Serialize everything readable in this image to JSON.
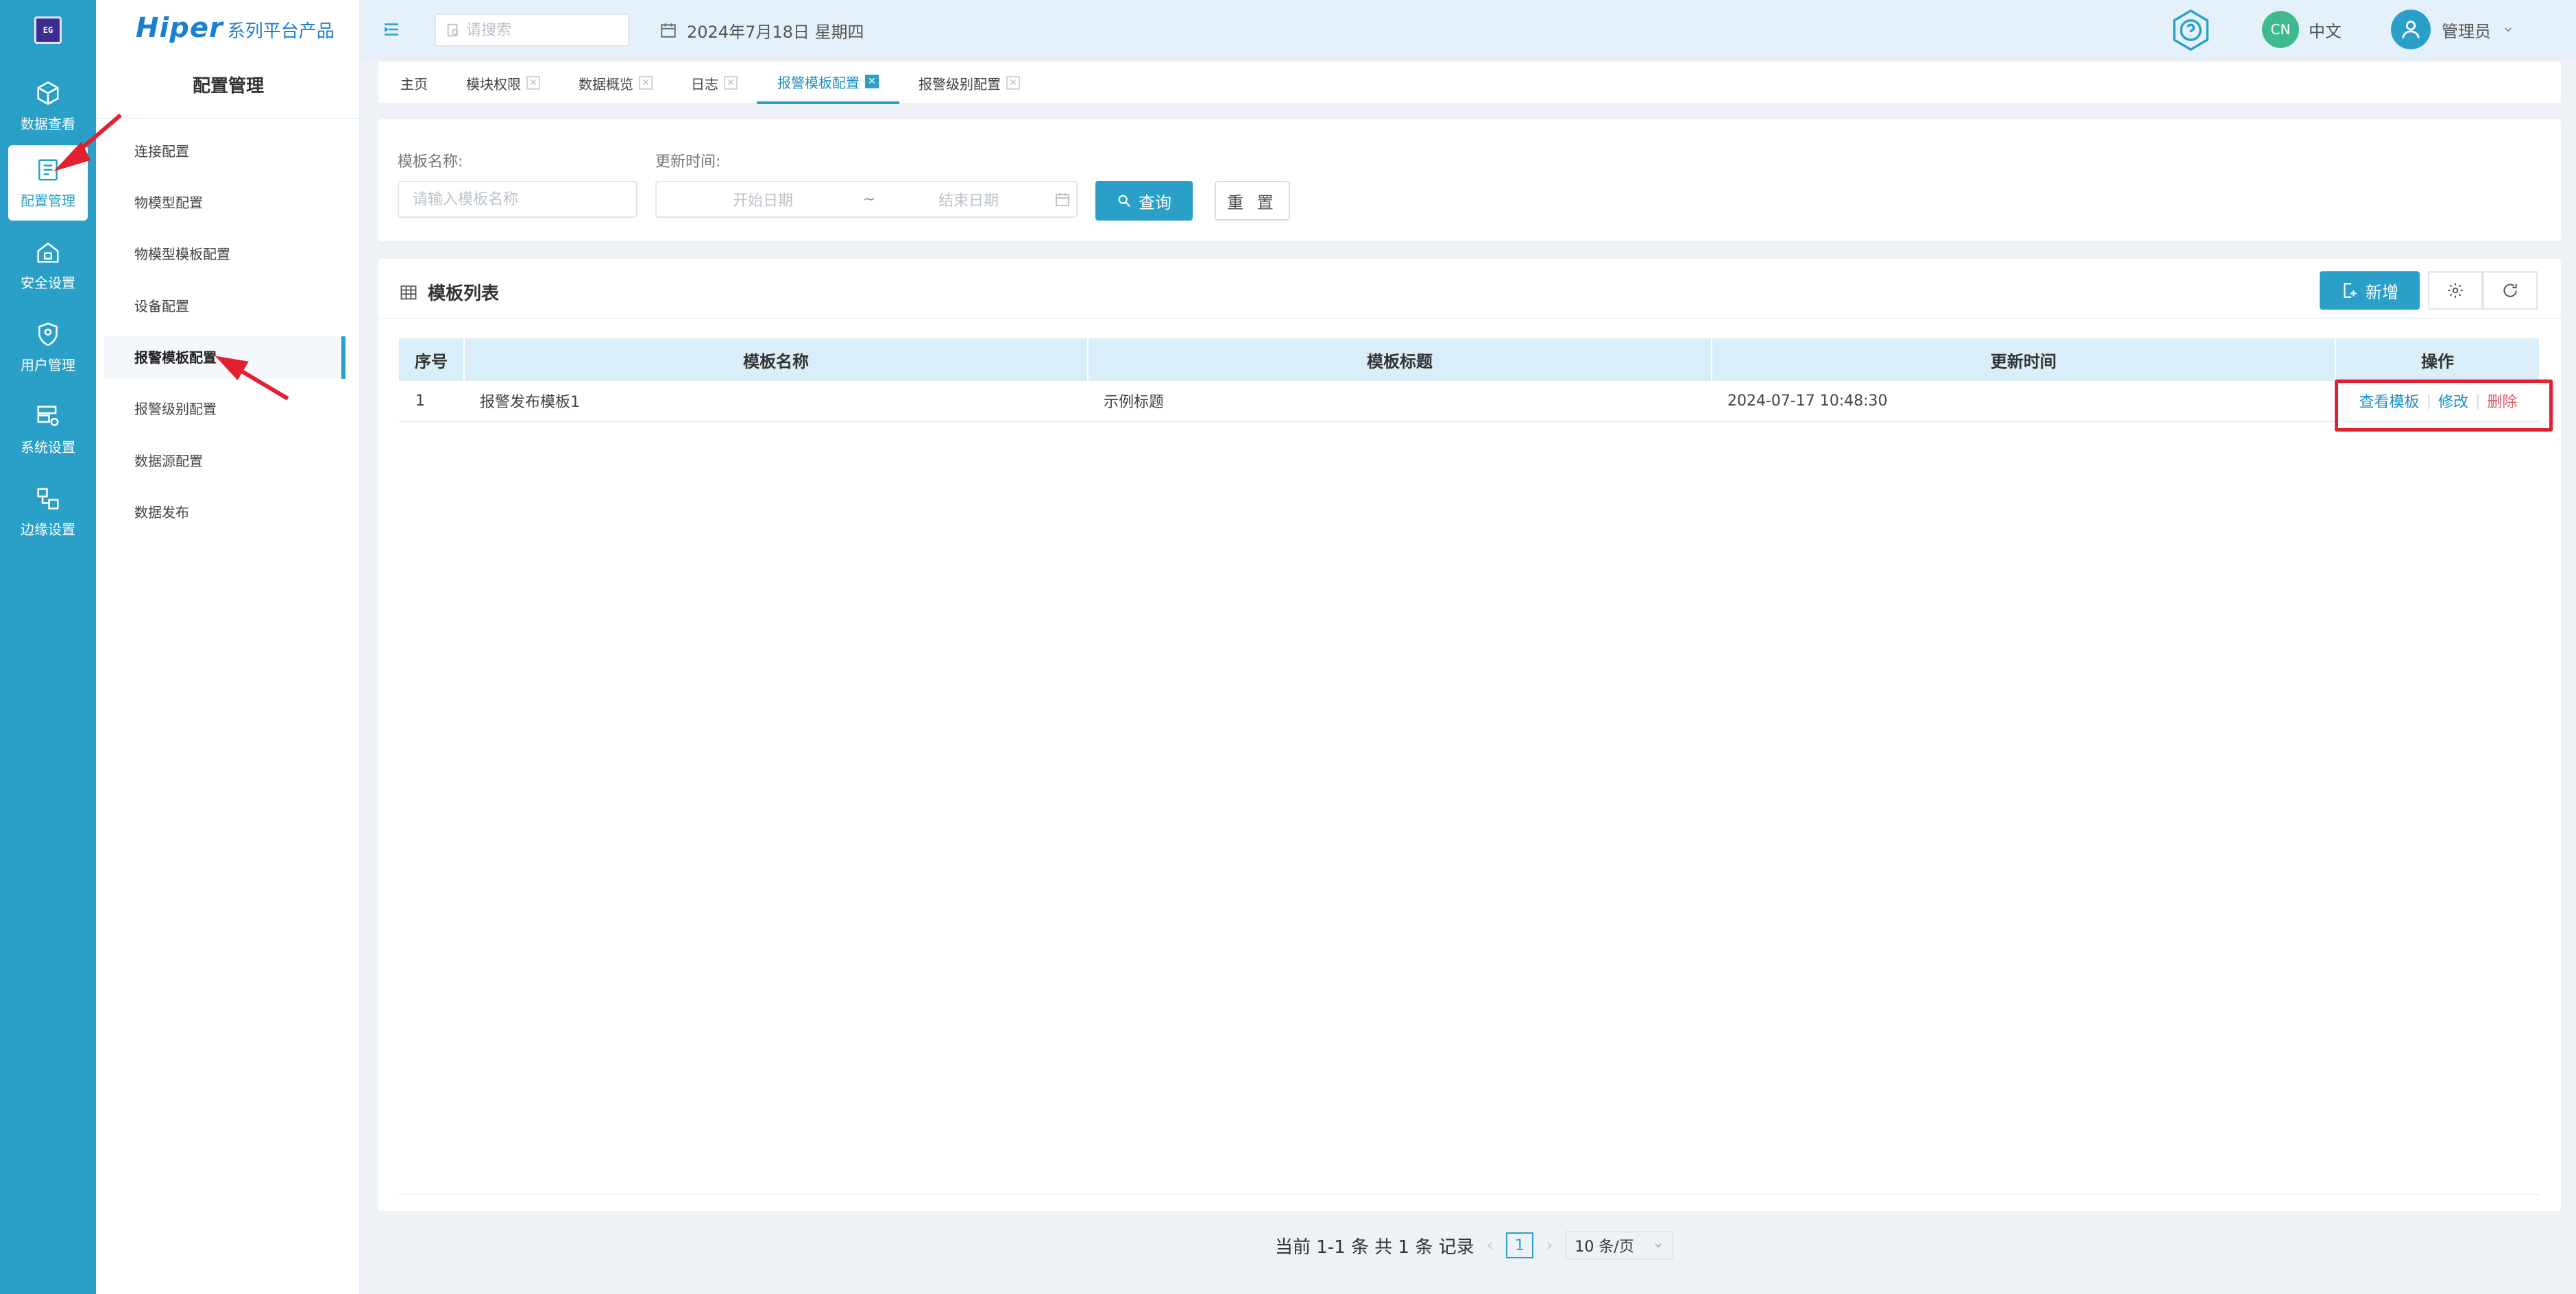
{
  "app": {
    "brand_main": "Hiper",
    "brand_sub": "系列平台产品",
    "logo_text": "EG"
  },
  "rail": {
    "items": [
      {
        "label": "数据查看",
        "icon": "cube-icon"
      },
      {
        "label": "配置管理",
        "icon": "config-icon"
      },
      {
        "label": "安全设置",
        "icon": "home-lock-icon"
      },
      {
        "label": "用户管理",
        "icon": "shield-user-icon"
      },
      {
        "label": "系统设置",
        "icon": "server-gear-icon"
      },
      {
        "label": "边缘设置",
        "icon": "edge-icon"
      }
    ]
  },
  "sidebar": {
    "title": "配置管理",
    "items": [
      {
        "label": "连接配置"
      },
      {
        "label": "物模型配置"
      },
      {
        "label": "物模型模板配置"
      },
      {
        "label": "设备配置"
      },
      {
        "label": "报警模板配置"
      },
      {
        "label": "报警级别配置"
      },
      {
        "label": "数据源配置"
      },
      {
        "label": "数据发布"
      }
    ]
  },
  "header": {
    "search_placeholder": "请搜索",
    "date": "2024年7月18日 星期四",
    "lang_badge": "CN",
    "lang_label": "中文",
    "user": "管理员"
  },
  "tabs": [
    {
      "label": "主页"
    },
    {
      "label": "模块权限"
    },
    {
      "label": "数据概览"
    },
    {
      "label": "日志"
    },
    {
      "label": "报警模板配置"
    },
    {
      "label": "报警级别配置"
    }
  ],
  "filter": {
    "name_label": "模板名称:",
    "name_placeholder": "请输入模板名称",
    "time_label": "更新时间:",
    "start_placeholder": "开始日期",
    "range_sep": "~",
    "end_placeholder": "结束日期",
    "query_btn": "查询",
    "reset_btn": "重 置"
  },
  "list": {
    "title": "模板列表",
    "add_btn": "新增",
    "columns": [
      "序号",
      "模板名称",
      "模板标题",
      "更新时间",
      "操作"
    ],
    "rows": [
      {
        "index": "1",
        "name": "报警发布模板1",
        "title": "示例标题",
        "updated": "2024-07-17 10:48:30"
      }
    ],
    "actions": {
      "view": "查看模板",
      "edit": "修改",
      "delete": "删除"
    }
  },
  "pager": {
    "summary": "当前 1-1 条 共 1 条 记录",
    "current_page": "1",
    "page_size": "10 条/页"
  },
  "colors": {
    "primary": "#2aa0c8",
    "danger": "#e05a6b",
    "annotation": "#e3202e"
  }
}
